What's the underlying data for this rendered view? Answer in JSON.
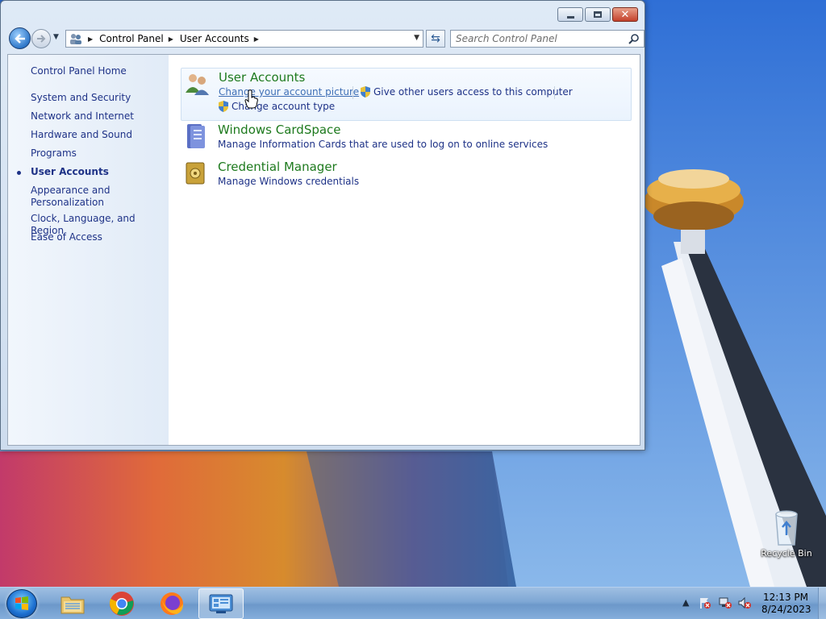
{
  "window": {
    "breadcrumb": [
      "Control Panel",
      "User Accounts"
    ],
    "search_placeholder": "Search Control Panel"
  },
  "sidebar": {
    "home": "Control Panel Home",
    "items": [
      {
        "label": "System and Security"
      },
      {
        "label": "Network and Internet"
      },
      {
        "label": "Hardware and Sound"
      },
      {
        "label": "Programs"
      },
      {
        "label": "User Accounts",
        "active": true
      },
      {
        "label": "Appearance and Personalization"
      },
      {
        "label": "Clock, Language, and Region"
      },
      {
        "label": "Ease of Access"
      }
    ]
  },
  "categories": [
    {
      "title": "User Accounts",
      "icon": "users-icon",
      "links": [
        "Change your account picture",
        "Give other users access to this computer",
        "Change account type"
      ]
    },
    {
      "title": "Windows CardSpace",
      "icon": "cardspace-icon",
      "links": [
        "Manage Information Cards that are used to log on to online services"
      ]
    },
    {
      "title": "Credential Manager",
      "icon": "vault-icon",
      "links": [
        "Manage Windows credentials"
      ]
    }
  ],
  "desktop": {
    "recycle_bin": "Recycle Bin"
  },
  "taskbar": {
    "apps": [
      "file-explorer",
      "chrome",
      "firefox",
      "control-panel"
    ],
    "time": "12:13 PM",
    "date": "8/24/2023"
  },
  "colors": {
    "category_title": "#1e7a1e",
    "link": "#1e3287",
    "taskbar": "#7ea7d4"
  }
}
